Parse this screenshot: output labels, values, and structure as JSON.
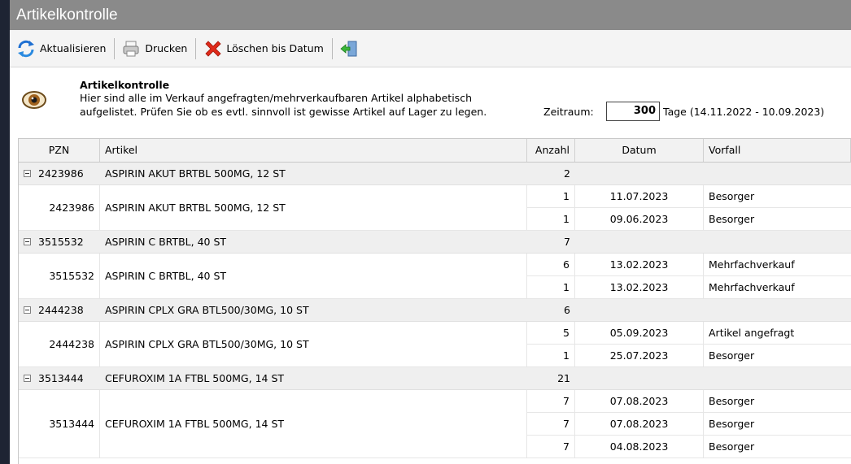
{
  "window": {
    "title": "Artikelkontrolle"
  },
  "toolbar": {
    "refresh_label": "Aktualisieren",
    "print_label": "Drucken",
    "delete_label": "Löschen bis Datum",
    "exit_icon": "exit-door-icon"
  },
  "info": {
    "heading": "Artikelkontrolle",
    "line1": "Hier sind alle im Verkauf angefragten/mehrverkaufbaren Artikel alphabetisch",
    "line2": "aufgelistet. Prüfen Sie ob es evtl. sinnvoll ist gewisse Artikel auf Lager zu legen.",
    "zeitraum_label": "Zeitraum:",
    "zeitraum_value": "300",
    "zeitraum_range": "Tage (14.11.2022 - 10.09.2023)"
  },
  "columns": {
    "pzn": "PZN",
    "artikel": "Artikel",
    "anzahl": "Anzahl",
    "datum": "Datum",
    "vorfall": "Vorfall"
  },
  "groups": [
    {
      "pzn": "2423986",
      "artikel": "ASPIRIN AKUT BRTBL 500MG,  12 ST",
      "anzahl": "2",
      "rows": [
        {
          "anzahl": "1",
          "datum": "11.07.2023",
          "vorfall": "Besorger"
        },
        {
          "anzahl": "1",
          "datum": "09.06.2023",
          "vorfall": "Besorger"
        }
      ]
    },
    {
      "pzn": "3515532",
      "artikel": "ASPIRIN C BRTBL,  40 ST",
      "anzahl": "7",
      "rows": [
        {
          "anzahl": "6",
          "datum": "13.02.2023",
          "vorfall": "Mehrfachverkauf"
        },
        {
          "anzahl": "1",
          "datum": "13.02.2023",
          "vorfall": "Mehrfachverkauf"
        }
      ]
    },
    {
      "pzn": "2444238",
      "artikel": "ASPIRIN CPLX GRA BTL500/30MG,  10 ST",
      "anzahl": "6",
      "rows": [
        {
          "anzahl": "5",
          "datum": "05.09.2023",
          "vorfall": "Artikel angefragt"
        },
        {
          "anzahl": "1",
          "datum": "25.07.2023",
          "vorfall": "Besorger"
        }
      ]
    },
    {
      "pzn": "3513444",
      "artikel": "CEFUROXIM 1A FTBL 500MG,  14 ST",
      "anzahl": "21",
      "rows": [
        {
          "anzahl": "7",
          "datum": "07.08.2023",
          "vorfall": "Besorger"
        },
        {
          "anzahl": "7",
          "datum": "07.08.2023",
          "vorfall": "Besorger"
        },
        {
          "anzahl": "7",
          "datum": "04.08.2023",
          "vorfall": "Besorger"
        }
      ]
    }
  ]
}
